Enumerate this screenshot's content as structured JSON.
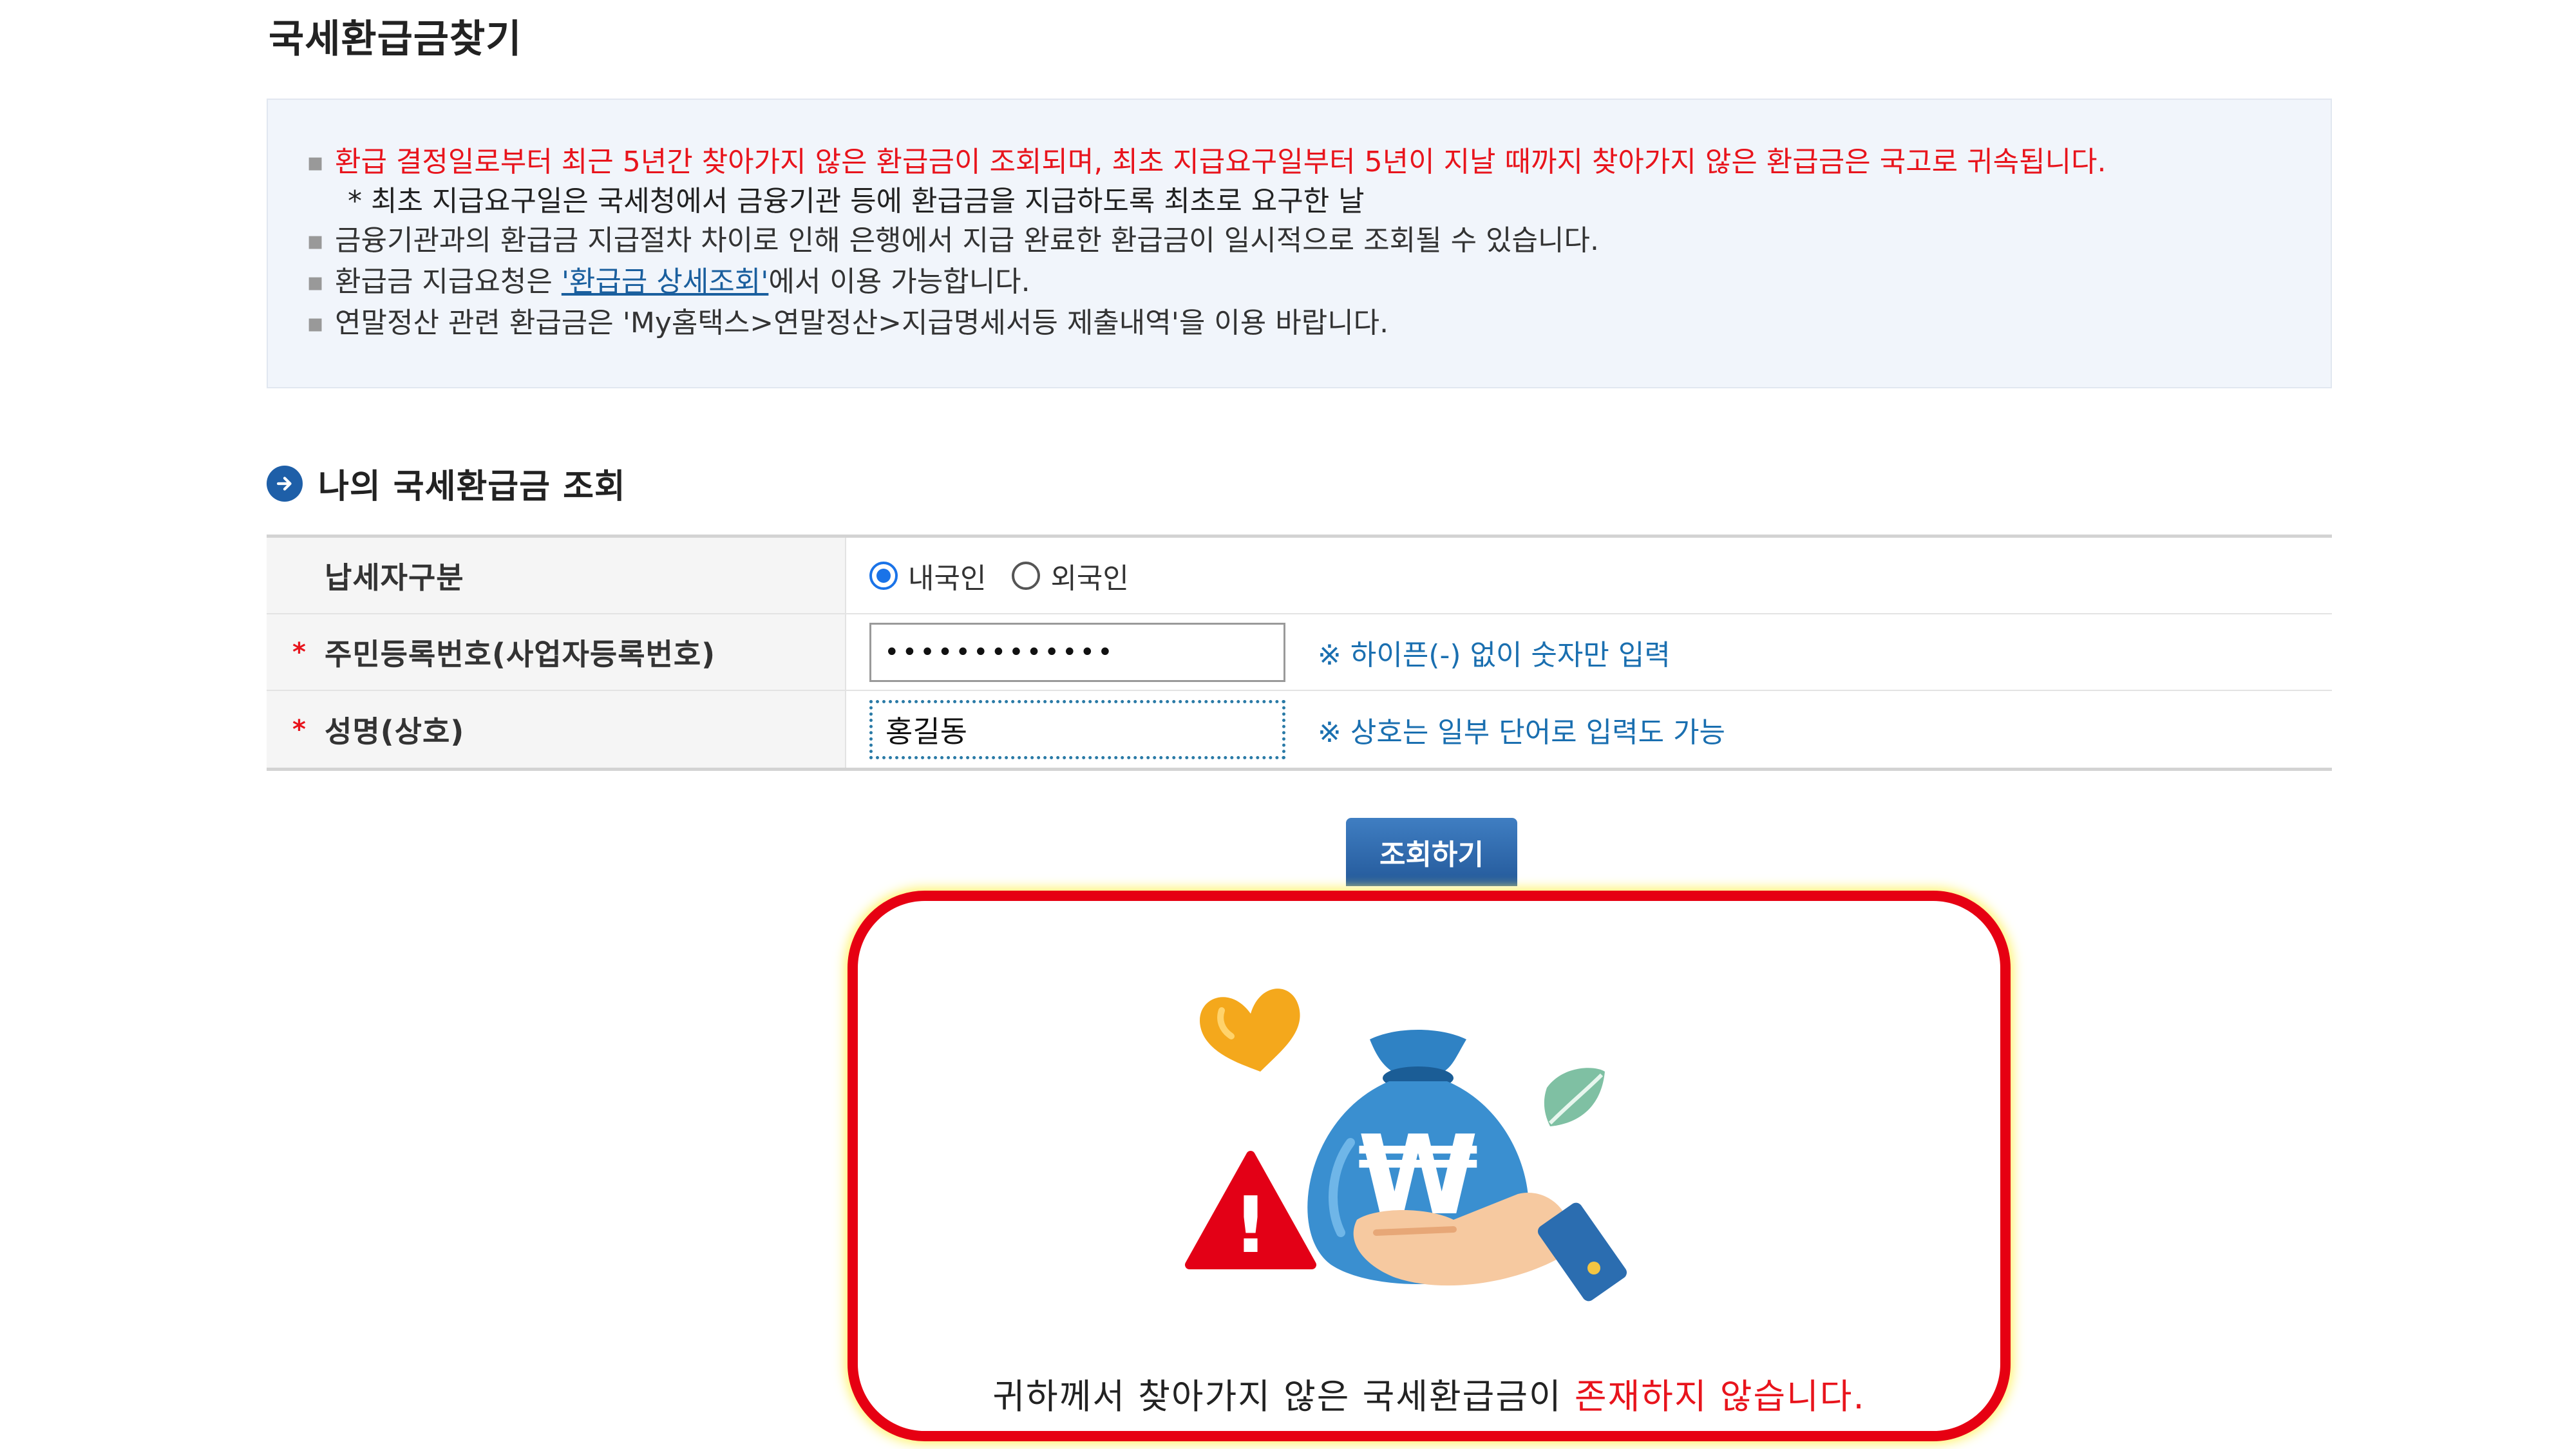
{
  "page": {
    "title": "국세환급금찾기"
  },
  "notice": {
    "items": [
      {
        "bullet": "▪",
        "text": "환급 결정일로부터 최근 5년간 찾아가지 않은 환급금이 조회되며, 최초 지급요구일부터 5년이 지날 때까지 찾아가지 않은 환급금은 국고로 귀속됩니다."
      },
      {
        "bullet": "▪",
        "text": "금융기관과의 환급금 지급절차 차이로 인해 은행에서 지급 완료한 환급금이 일시적으로 조회될 수 있습니다."
      },
      {
        "bullet": "▪",
        "prefix": "환급금 지급요청은 ",
        "link": "'환급금 상세조회'",
        "suffix": "에서 이용 가능합니다."
      },
      {
        "bullet": "▪",
        "text": "연말정산 관련 환급금은 'My홈택스>연말정산>지급명세서등 제출내역'을 이용 바랍니다."
      }
    ],
    "sub_note": "* 최초 지급요구일은 국세청에서 금융기관 등에 환급금을 지급하도록 최초로 요구한 날",
    "highlight_color": "#e8141c"
  },
  "section": {
    "title": "나의 국세환급금 조회",
    "icon": "arrow-right-circle-icon"
  },
  "form": {
    "required_mark": "*",
    "taxpayer_type": {
      "label": "납세자구분",
      "options": [
        "내국인",
        "외국인"
      ],
      "selected": "내국인"
    },
    "id_number": {
      "label": "주민등록번호(사업자등록번호)",
      "value": "•••••••••••••",
      "hint": "※ 하이픈(-) 없이 숫자만 입력"
    },
    "name": {
      "label": "성명(상호)",
      "value": "홍길동",
      "hint": "※ 상호는 일부 단어로 입력도 가능"
    }
  },
  "search_button": {
    "label": "조회하기"
  },
  "result": {
    "message_prefix": "귀하께서 찾아가지 않은 국세환급금이 ",
    "message_highlight": "존재하지 않습니다.",
    "illustration_symbol": "₩",
    "warning_symbol": "!"
  }
}
